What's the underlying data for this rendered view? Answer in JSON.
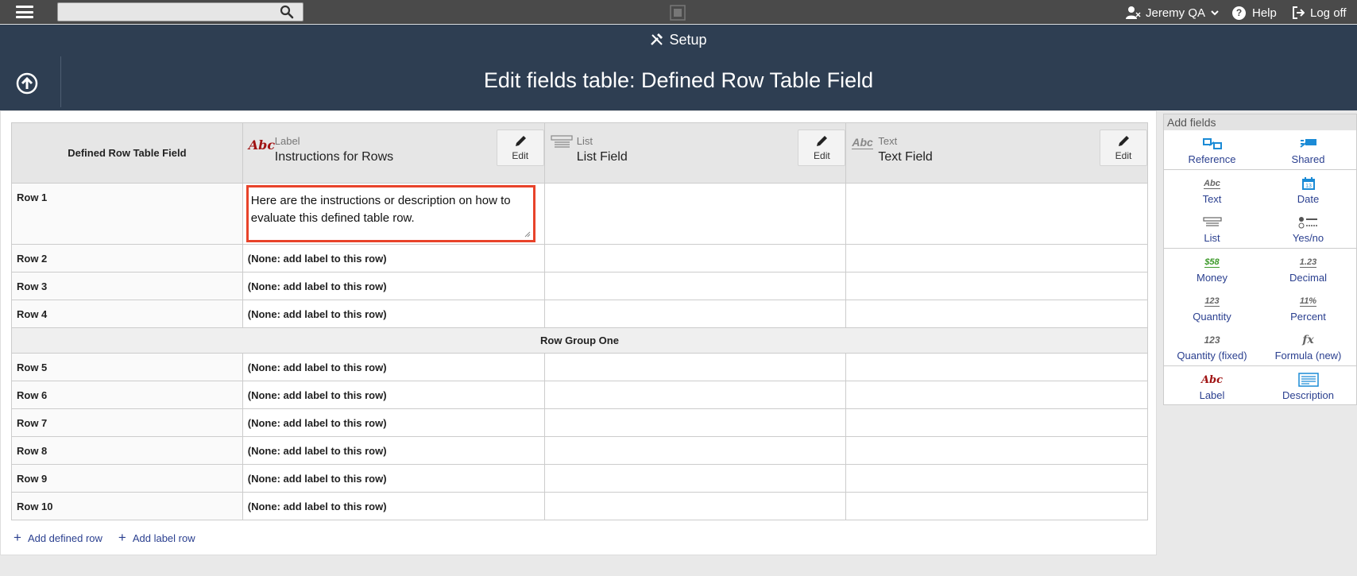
{
  "topbar": {
    "search_placeholder": "",
    "user_name": "Jeremy QA",
    "help_label": "Help",
    "logoff_label": "Log off"
  },
  "header": {
    "section": "Setup",
    "title": "Edit fields table: Defined Row Table Field"
  },
  "table": {
    "first_header": "Defined Row Table Field",
    "columns": [
      {
        "type": "Label",
        "name": "Instructions for Rows",
        "edit": "Edit",
        "icon": "abc-label-icon"
      },
      {
        "type": "List",
        "name": "List Field",
        "edit": "Edit",
        "icon": "list-icon"
      },
      {
        "type": "Text",
        "name": "Text Field",
        "edit": "Edit",
        "icon": "abc-text-icon"
      }
    ],
    "row1": {
      "label": "Row 1",
      "value": "Here are the instructions or description on how to evaluate this defined table row."
    },
    "rows_a": [
      {
        "label": "Row 2",
        "value": "(None: add label to this row)"
      },
      {
        "label": "Row 3",
        "value": "(None: add label to this row)"
      },
      {
        "label": "Row 4",
        "value": "(None: add label to this row)"
      }
    ],
    "group_label": "Row Group One",
    "rows_b": [
      {
        "label": "Row 5",
        "value": "(None: add label to this row)"
      },
      {
        "label": "Row 6",
        "value": "(None: add label to this row)"
      },
      {
        "label": "Row 7",
        "value": "(None: add label to this row)"
      },
      {
        "label": "Row 8",
        "value": "(None: add label to this row)"
      },
      {
        "label": "Row 9",
        "value": "(None: add label to this row)"
      },
      {
        "label": "Row 10",
        "value": "(None: add label to this row)"
      }
    ]
  },
  "links": {
    "add_defined_row": "Add defined row",
    "add_label_row": "Add label row"
  },
  "add_fields": {
    "title": "Add fields",
    "groups": [
      [
        {
          "label": "Reference",
          "icon": "reference-icon"
        },
        {
          "label": "Shared",
          "icon": "shared-icon"
        }
      ],
      [
        {
          "label": "Text",
          "icon": "abc-text-icon"
        },
        {
          "label": "Date",
          "icon": "calendar-icon"
        },
        {
          "label": "List",
          "icon": "list-icon"
        },
        {
          "label": "Yes/no",
          "icon": "yes-no-icon"
        }
      ],
      [
        {
          "label": "Money",
          "icon": "money-icon"
        },
        {
          "label": "Decimal",
          "icon": "decimal-icon"
        },
        {
          "label": "Quantity",
          "icon": "quantity-icon"
        },
        {
          "label": "Percent",
          "icon": "percent-icon"
        },
        {
          "label": "Quantity (fixed)",
          "icon": "quantity-fixed-icon"
        },
        {
          "label": "Formula (new)",
          "icon": "formula-icon"
        }
      ],
      [
        {
          "label": "Label",
          "icon": "abc-label-icon"
        },
        {
          "label": "Description",
          "icon": "description-icon"
        }
      ]
    ],
    "icon_text": {
      "abc": "Abc",
      "money": "$58",
      "decimal": "1.23",
      "quantity": "123",
      "percent": "11%",
      "fx": "fx",
      "date_num": "13"
    }
  },
  "colors": {
    "topbar": "#4a4a4a",
    "header": "#2e3e52",
    "link": "#2a3f8f",
    "highlight": "#e8432a",
    "label_red": "#a01414",
    "money_green": "#3d9a2a",
    "date_blue": "#1b8bd6"
  }
}
